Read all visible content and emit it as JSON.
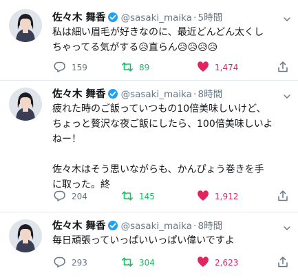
{
  "tweets": [
    {
      "name": "佐々木 舞香",
      "handle": "@sasaki_maika",
      "separator": "·",
      "time": "5時間",
      "text": "私は細い眉毛が好きなのに、最近どんどん太くし\nちゃってる気がする😥直らん😥😥😥😥",
      "replies": "159",
      "retweets": "89",
      "likes": "1,474"
    },
    {
      "name": "佐々木 舞香",
      "handle": "@sasaki_maika",
      "separator": "·",
      "time": "8時間",
      "text": "疲れた時のご飯っていつもの10倍美味しいけど、\nちょっと贅沢な夜ご飯にしたら、100倍美味しいよ\nねー！\n\n佐々木はそう思いながらも、かんぴょう巻きを手\nに取った。終",
      "replies": "204",
      "retweets": "145",
      "likes": "1,912"
    },
    {
      "name": "佐々木 舞香",
      "handle": "@sasaki_maika",
      "separator": "·",
      "time": "8時間",
      "text": "毎日頑張っていっぱいいっぱい偉いですよ",
      "replies": "293",
      "retweets": "304",
      "likes": "2,623"
    }
  ],
  "icons": {
    "reply": "reply-icon",
    "retweet": "retweet-icon",
    "like": "heart-icon",
    "share": "share-icon",
    "verified": "verified-badge-icon",
    "menu": "chevron-down-icon"
  },
  "colors": {
    "text": "#14171a",
    "secondary": "#657786",
    "verified": "#1da1f2",
    "retweet": "#17bf63",
    "like": "#e0245e",
    "divider": "#e1e8ed"
  }
}
